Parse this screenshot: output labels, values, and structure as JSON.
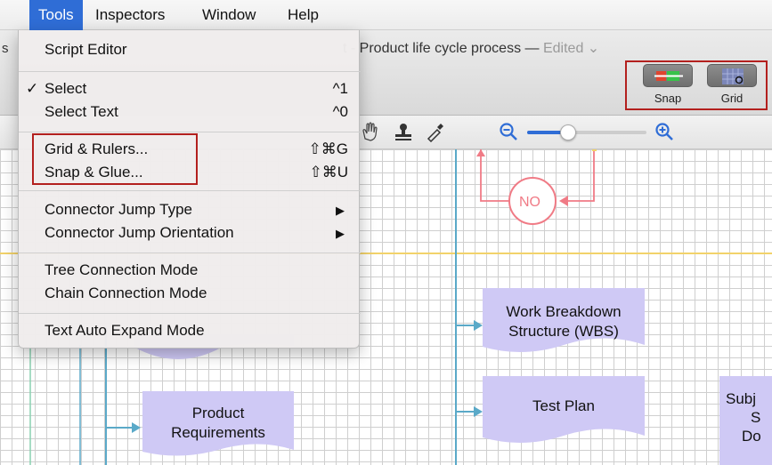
{
  "menubar": {
    "items": [
      "Tools",
      "Inspectors",
      "Window",
      "Help"
    ],
    "active": "Tools"
  },
  "window": {
    "title_fragment_left": "s",
    "title": "t - Product life cycle process",
    "separator": " — ",
    "edited": "Edited",
    "edited_chevron": "⌄"
  },
  "toolbar": {
    "snap_label": "Snap",
    "grid_label": "Grid"
  },
  "tools_menu": {
    "items": [
      {
        "label": "Script Editor",
        "checked": false,
        "shortcut": ""
      },
      {
        "label": "Select",
        "checked": true,
        "shortcut": "^1"
      },
      {
        "label": "Select Text",
        "checked": false,
        "shortcut": "^0"
      },
      {
        "label": "Grid & Rulers...",
        "checked": false,
        "shortcut": "⇧⌘G"
      },
      {
        "label": "Snap & Glue...",
        "checked": false,
        "shortcut": "⇧⌘U"
      },
      {
        "label": "Connector Jump Type",
        "checked": false,
        "submenu": true
      },
      {
        "label": "Connector Jump Orientation",
        "checked": false,
        "submenu": true
      },
      {
        "label": "Tree Connection Mode",
        "checked": false,
        "shortcut": ""
      },
      {
        "label": "Chain Connection Mode",
        "checked": false,
        "shortcut": ""
      },
      {
        "label": "Text Auto Expand Mode",
        "checked": false,
        "shortcut": ""
      }
    ],
    "check_mark": "✓",
    "submenu_arrow": "▶"
  },
  "diagram": {
    "decision_label": "NO",
    "wbs_line1": "Work Breakdown",
    "wbs_line2": "Structure (WBS)",
    "test_plan": "Test Plan",
    "product_req_line1": "Product",
    "product_req_line2": "Requirements",
    "cut_line1": "Subj",
    "cut_line2": "S",
    "cut_line3": "Do"
  },
  "colors": {
    "highlight": "#b3201e",
    "menu_active": "#2f6dd6",
    "shape_fill": "#cfc9f5",
    "connector": "#5aa9c8",
    "decision": "#f07b86",
    "guide": "#f2d26a"
  }
}
